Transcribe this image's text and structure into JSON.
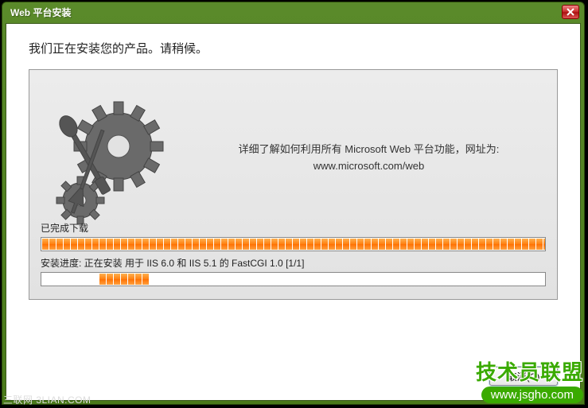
{
  "window": {
    "title": "Web 平台安装"
  },
  "heading": "我们正在安装您的产品。请稍候。",
  "promo": {
    "line1": "详细了解如何利用所有 Microsoft Web 平台功能，网址为:",
    "line2": "www.microsoft.com/web"
  },
  "progress": {
    "download": {
      "label": "已完成下载",
      "percent": 100
    },
    "install": {
      "label": "安装进度: 正在安装 用于 IIS 6.0 和 IIS 5.1 的 FastCGI 1.0 [1/1]",
      "percent": 10,
      "offset_percent": 11
    }
  },
  "buttons": {
    "cancel": "取消(C)"
  },
  "watermark": {
    "brand": "技术员联盟",
    "url": "www.jsgho.com"
  },
  "footer": "三联网 3LIAN.COM"
}
